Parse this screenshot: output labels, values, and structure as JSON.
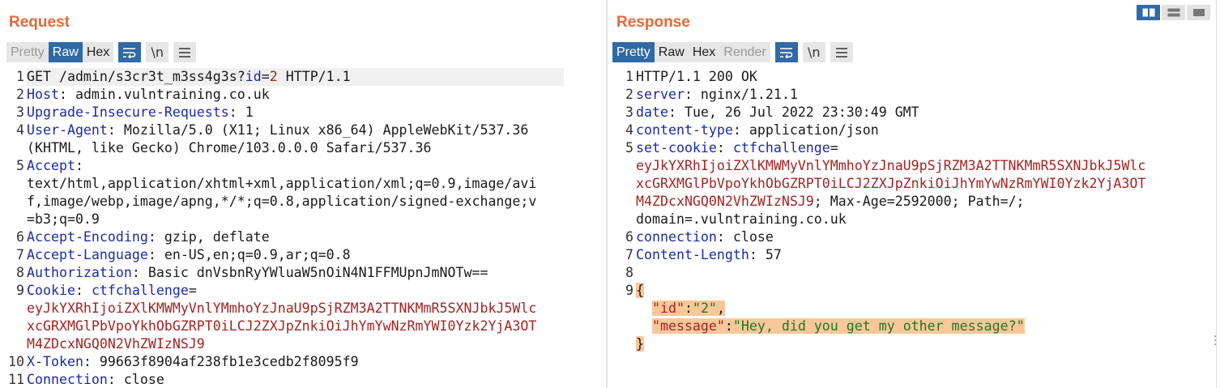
{
  "request": {
    "title": "Request",
    "tabs": {
      "pretty": "Pretty",
      "raw": "Raw",
      "hex": "Hex"
    },
    "newline_label": "\\n",
    "lines": [
      {
        "n": "1",
        "method_path": "GET /admin/s3cr3t_m3ss4g3s?",
        "param_name": "id",
        "param_eq": "=",
        "param_val": "2",
        "proto": " HTTP/1.1"
      },
      {
        "n": "2",
        "name": "Host",
        "value": ": admin.vulntraining.co.uk"
      },
      {
        "n": "3",
        "name": "Upgrade-Insecure-Requests",
        "value": ": 1"
      },
      {
        "n": "4",
        "name": "User-Agent",
        "value": ": Mozilla/5.0 (X11; Linux x86_64) AppleWebKit/537.36",
        "cont": [
          "(KHTML, like Gecko) Chrome/103.0.0.0 Safari/537.36"
        ]
      },
      {
        "n": "5",
        "name": "Accept",
        "value": ":",
        "cont": [
          "text/html,application/xhtml+xml,application/xml;q=0.9,image/avi",
          "f,image/webp,image/apng,*/*;q=0.8,application/signed-exchange;v",
          "=b3;q=0.9"
        ]
      },
      {
        "n": "6",
        "name": "Accept-Encoding",
        "value": ": gzip, deflate"
      },
      {
        "n": "7",
        "name": "Accept-Language",
        "value": ": en-US,en;q=0.9,ar;q=0.8"
      },
      {
        "n": "8",
        "name": "Authorization",
        "value": ": Basic dnVsbnRyYWluaW5nOiN4N1FFMUpnJmNOTw=="
      },
      {
        "n": "9",
        "name": "Cookie",
        "value": ": ",
        "cookie_name": "ctfchallenge",
        "cookie_eq": "=",
        "cont": [
          "eyJkYXRhIjoiZXlKMWMyVnlYMmhoYzJnaU9pSjRZM3A2TTNKMmR5SXNJbkJ5Wlc",
          "xcGRXMGlPbVpoYkhObGZRPT0iLCJ2ZXJpZnkiOiJhYmYwNzRmYWI0Yzk2YjA3OT",
          "M4ZDcxNGQ0N2VhZWIzNSJ9"
        ]
      },
      {
        "n": "10",
        "name": "X-Token",
        "value": ": 99663f8904af238fb1e3cedb2f8095f9"
      },
      {
        "n": "11",
        "name": "Connection",
        "value": ": close"
      }
    ]
  },
  "response": {
    "title": "Response",
    "tabs": {
      "pretty": "Pretty",
      "raw": "Raw",
      "hex": "Hex",
      "render": "Render"
    },
    "newline_label": "\\n",
    "status_line": "HTTP/1.1 200 OK",
    "headers": [
      {
        "n": "2",
        "name": "server",
        "value": ": nginx/1.21.1"
      },
      {
        "n": "3",
        "name": "date",
        "value": ": Tue, 26 Jul 2022 23:30:49 GMT"
      },
      {
        "n": "4",
        "name": "content-type",
        "value": ": application/json"
      }
    ],
    "set_cookie": {
      "n": "5",
      "name": "set-cookie",
      "sep": ": ",
      "cookie_name": "ctfchallenge",
      "eq": "=",
      "value_lines": [
        "eyJkYXRhIjoiZXlKMWMyVnlYMmhoYzJnaU9pSjRZM3A2TTNKMmR5SXNJbkJ5Wlc",
        "xcGRXMGlPbVpoYkhObGZRPT0iLCJ2ZXJpZnkiOiJhYmYwNzRmYWI0Yzk2YjA3OT",
        "M4ZDcxNGQ0N2VhZWIzNSJ9"
      ],
      "attrs_tail": "; Max-Age=2592000; Path=/;",
      "domain_line": "domain=.vulntraining.co.uk"
    },
    "headers2": [
      {
        "n": "6",
        "name": "connection",
        "value": ": close"
      },
      {
        "n": "7",
        "name": "Content-Length",
        "value": ": 57"
      }
    ],
    "json": {
      "open": "{",
      "close": "}",
      "id_key": "\"id\"",
      "id_val": "\"2\"",
      "msg_key": "\"message\"",
      "msg_val": "\"Hey, did you get my other message?\""
    }
  },
  "view_toggle": [
    "split-horizontal-icon",
    "split-vertical-icon",
    "single-pane-icon"
  ],
  "colors": {
    "accent": "#e8673b",
    "active": "#2f6aa7",
    "header_name": "#1b2ba8",
    "cookie": "#a52323",
    "json_string": "#1b7a23",
    "json_highlight": "#f8c79a"
  }
}
